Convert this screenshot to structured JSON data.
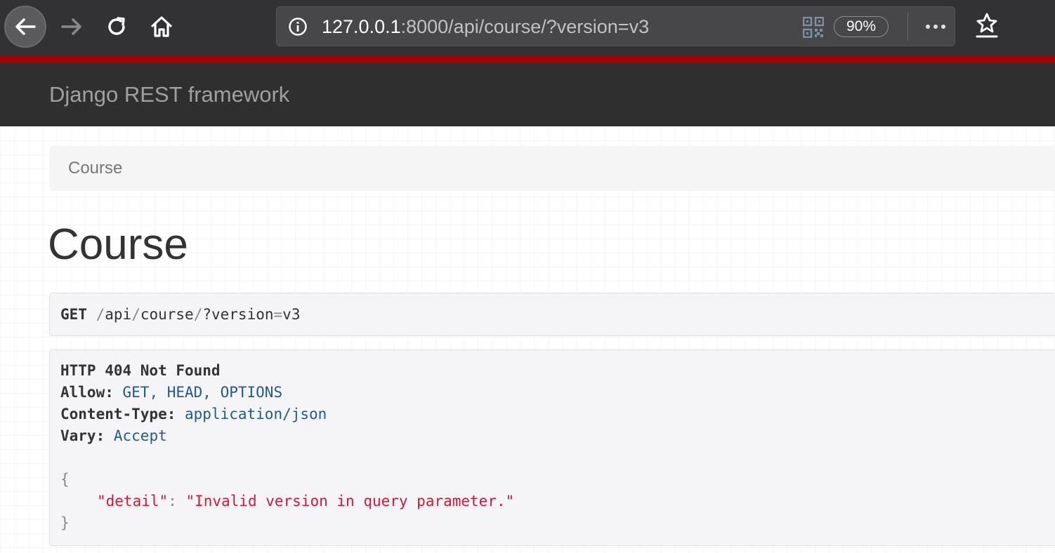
{
  "browser": {
    "url_host": "127.0.0.1",
    "url_rest": ":8000/api/course/?version=v3",
    "zoom": "90%"
  },
  "navbar": {
    "brand": "Django REST framework"
  },
  "breadcrumb": {
    "items": [
      "Course"
    ]
  },
  "page": {
    "title": "Course"
  },
  "request": {
    "method": "GET",
    "path_segments": [
      "api",
      "course",
      "?version",
      "v3"
    ]
  },
  "response": {
    "status_line": "HTTP 404 Not Found",
    "headers": [
      {
        "key": "Allow",
        "value": "GET, HEAD, OPTIONS"
      },
      {
        "key": "Content-Type",
        "value": "application/json"
      },
      {
        "key": "Vary",
        "value": "Accept"
      }
    ],
    "body": {
      "open_brace": "{",
      "key": "\"detail\"",
      "value": "\"Invalid version in query parameter.\"",
      "close_brace": "}"
    }
  },
  "colors": {
    "navbar_bg": "#2f2f2f",
    "accent_red": "#a30000",
    "header_value": "#1f5a96",
    "json_string": "#d01a3a"
  },
  "icons": {
    "back": "back-arrow-icon",
    "forward": "forward-arrow-icon",
    "reload": "reload-icon",
    "home": "home-icon",
    "info": "info-icon",
    "qr": "qr-code-icon",
    "more": "more-dots-icon",
    "bookmark": "bookmark-star-icon"
  }
}
